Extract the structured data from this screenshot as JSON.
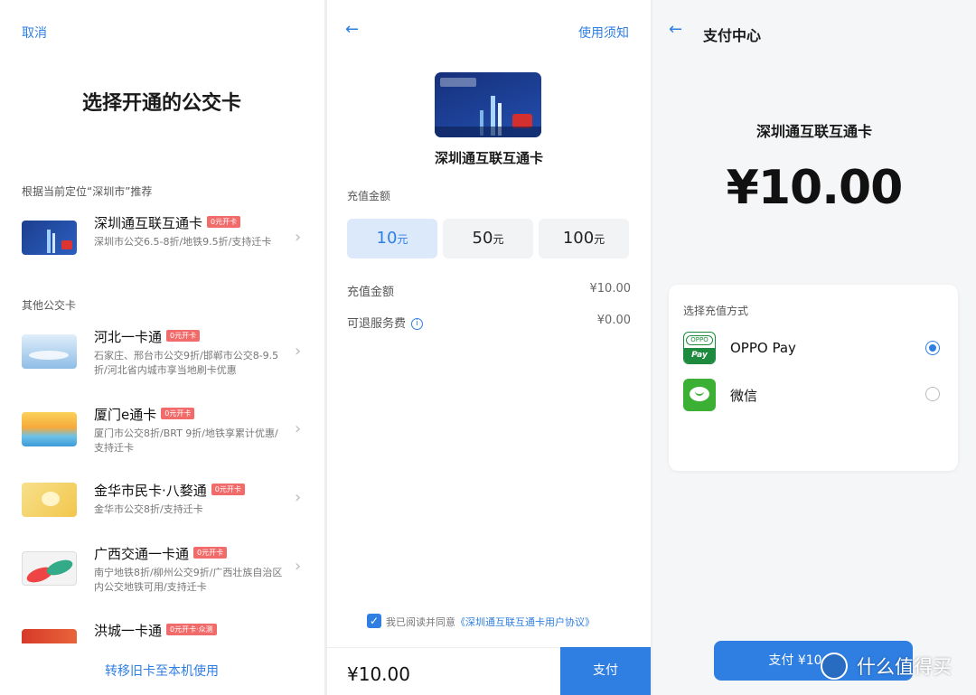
{
  "panel1": {
    "cancel_label": "取消",
    "title": "选择开通的公交卡",
    "recommend_label": "根据当前定位“深圳市”推荐",
    "other_label": "其他公交卡",
    "recommended": [
      {
        "name": "深圳通互联互通卡",
        "badge": "0元开卡",
        "desc": "深圳市公交6.5-8折/地铁9.5折/支持迁卡"
      }
    ],
    "others": [
      {
        "name": "河北一卡通",
        "badge": "0元开卡",
        "desc": "石家庄、邢台市公交9折/邯郸市公交8-9.5折/河北省内城市享当地刷卡优惠"
      },
      {
        "name": "厦门e通卡",
        "badge": "0元开卡",
        "desc": "厦门市公交8折/BRT 9折/地铁享累计优惠/支持迁卡"
      },
      {
        "name": "金华市民卡·八婺通",
        "badge": "0元开卡",
        "desc": "金华市公交8折/支持迁卡"
      },
      {
        "name": "广西交通一卡通",
        "badge": "0元开卡",
        "desc": "南宁地铁8折/柳州公交9折/广西壮族自治区内公交地铁可用/支持迁卡"
      },
      {
        "name": "洪城一卡通",
        "badge": "0元开卡·众测",
        "desc": ""
      }
    ],
    "transfer_label": "转移旧卡至本机使用"
  },
  "panel2": {
    "back_icon": "arrow-left-icon",
    "help_label": "使用须知",
    "card_name": "深圳通互联互通卡",
    "recharge_label": "充值金额",
    "amounts": [
      {
        "value": "10",
        "unit": "元",
        "selected": true
      },
      {
        "value": "50",
        "unit": "元",
        "selected": false
      },
      {
        "value": "100",
        "unit": "元",
        "selected": false
      }
    ],
    "rows": [
      {
        "label": "充值金额",
        "value": "¥10.00"
      },
      {
        "label": "可退服务费",
        "value": "¥0.00"
      }
    ],
    "agree_text": "我已阅读并同意",
    "agree_link": "《深圳通互联互通卡用户协议》",
    "total": "¥10.00",
    "pay_label": "支付"
  },
  "panel3": {
    "title": "支付中心",
    "card_name": "深圳通互联互通卡",
    "amount": "¥10.00",
    "method_label": "选择充值方式",
    "methods": [
      {
        "name": "OPPO Pay",
        "icon": "oppo-pay-icon",
        "selected": true,
        "icon_top": "OPPO",
        "icon_bottom": "Pay"
      },
      {
        "name": "微信",
        "icon": "wechat-icon",
        "selected": false
      }
    ],
    "pay_button": "支付 ¥10",
    "watermark": "什么值得买"
  },
  "colors": {
    "accent": "#2f7fe3",
    "badge": "#f26b6b",
    "oppo": "#1d8a3e",
    "wechat": "#3cb035"
  }
}
